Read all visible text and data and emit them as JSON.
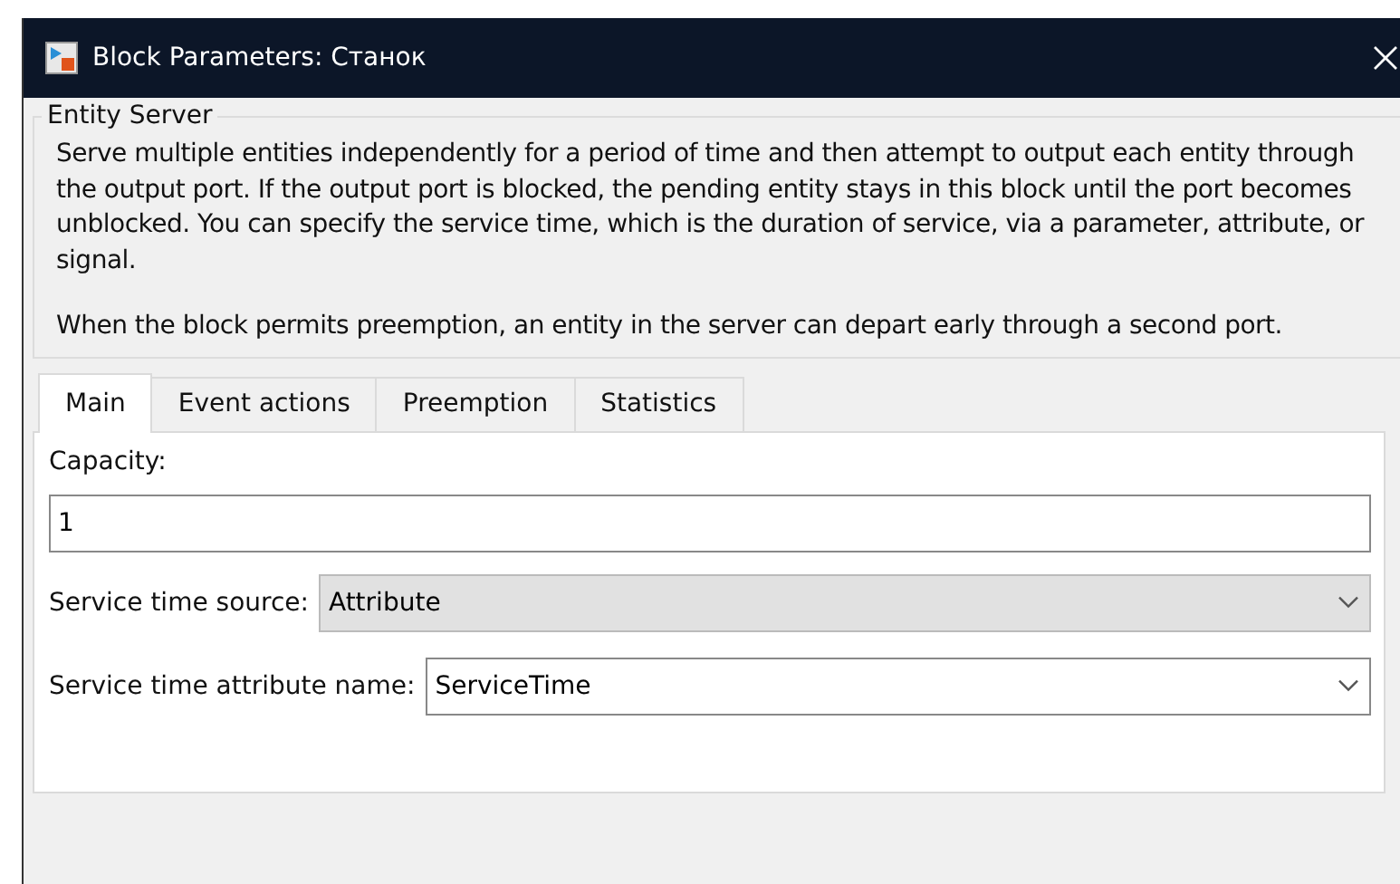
{
  "window": {
    "title": "Block Parameters: Станок"
  },
  "group": {
    "title": "Entity Server",
    "paragraphs": [
      "Serve multiple entities independently for a period of time and then attempt to output each entity through the output port. If the output port is blocked, the pending entity stays in this block until the port becomes unblocked. You can specify the service time, which is the duration of service, via a parameter, attribute, or signal.",
      "When the block permits preemption, an entity in the server can depart early through a second port."
    ]
  },
  "tabs": [
    {
      "label": "Main",
      "selected": true
    },
    {
      "label": "Event actions",
      "selected": false
    },
    {
      "label": "Preemption",
      "selected": false
    },
    {
      "label": "Statistics",
      "selected": false
    }
  ],
  "fields": [
    {
      "kind": "text",
      "label": "Capacity:",
      "value": "1"
    },
    {
      "kind": "dropdown",
      "label": "Service time source:",
      "value": "Attribute",
      "editable": false
    },
    {
      "kind": "dropdown",
      "label": "Service time attribute name:",
      "value": "ServiceTime",
      "editable": true
    }
  ]
}
